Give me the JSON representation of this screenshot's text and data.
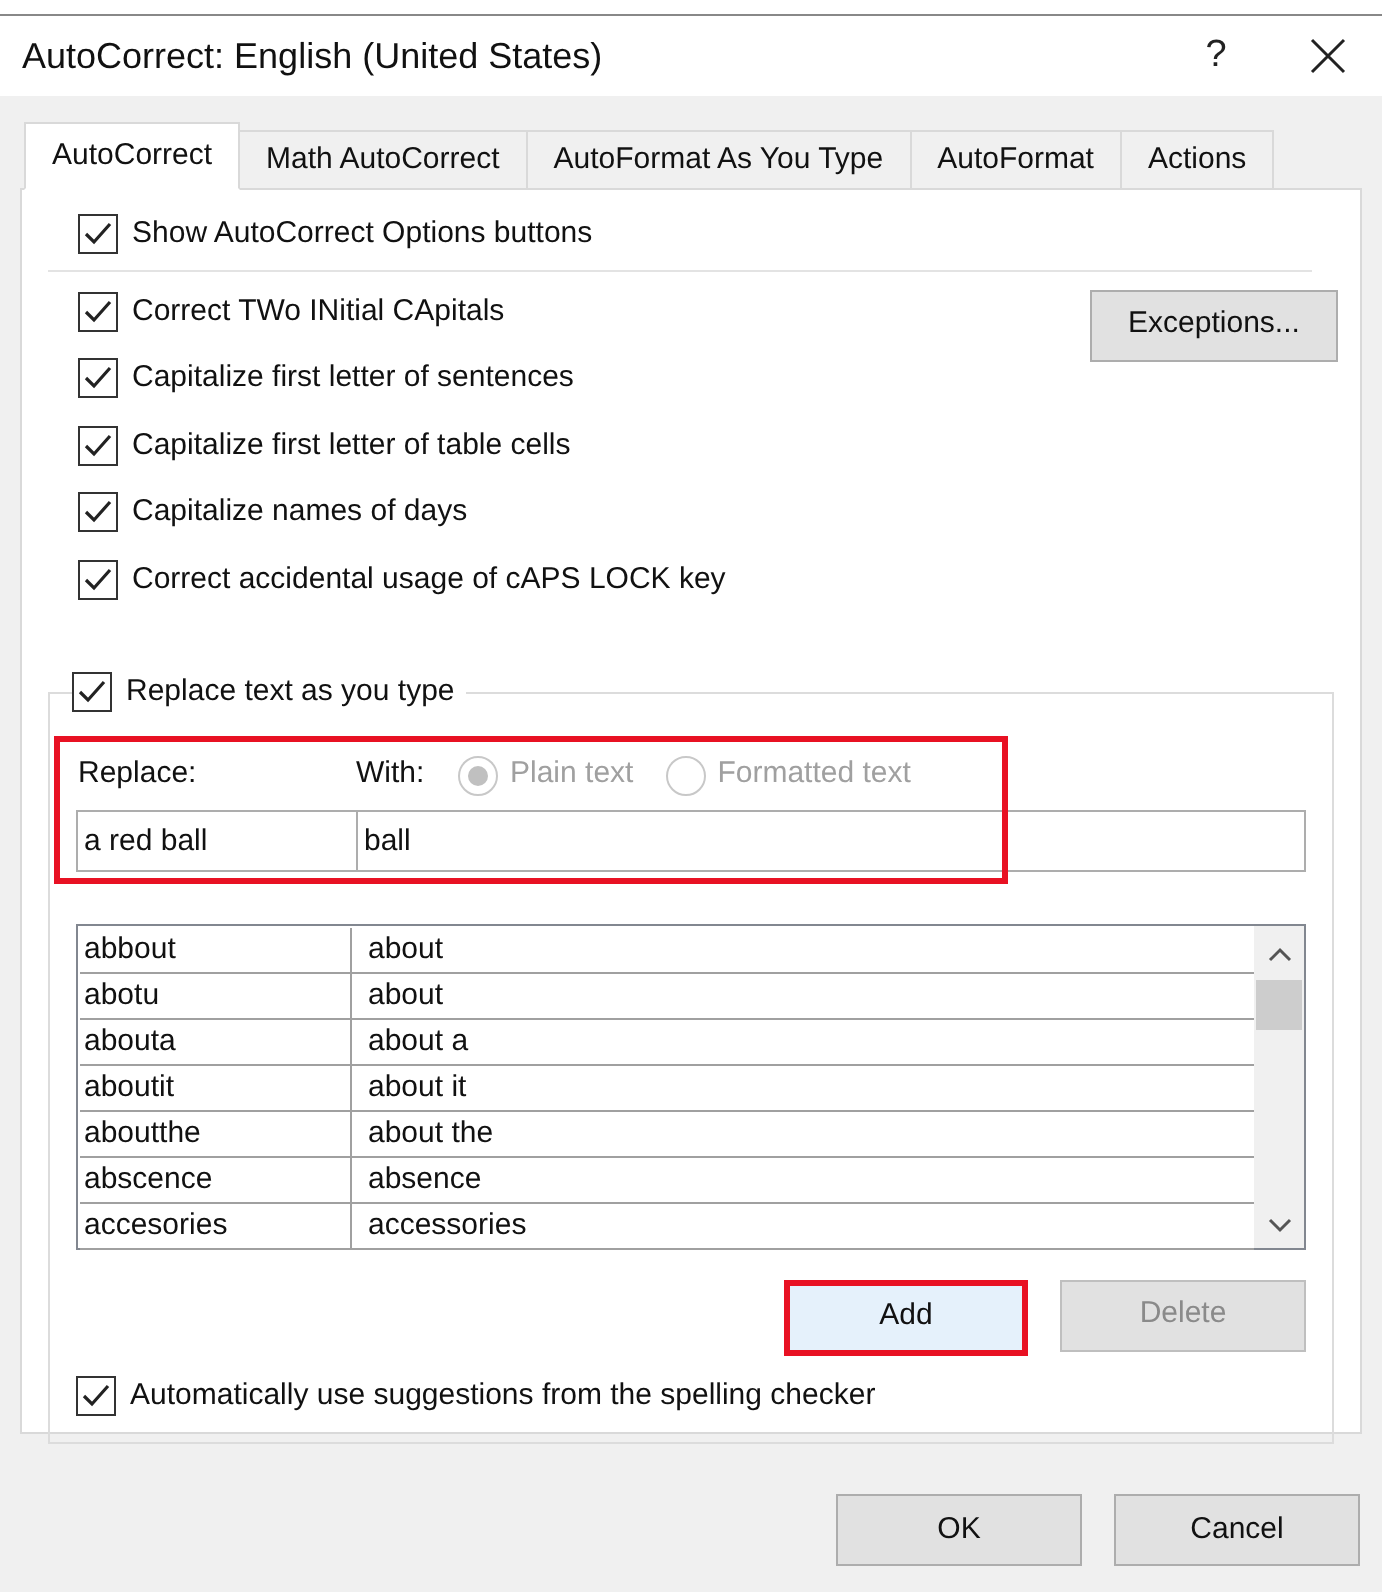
{
  "window": {
    "title": "AutoCorrect: English (United States)",
    "help": "?"
  },
  "tabs": [
    {
      "label": "AutoCorrect",
      "selected": true
    },
    {
      "label": "Math AutoCorrect",
      "selected": false
    },
    {
      "label": "AutoFormat As You Type",
      "selected": false
    },
    {
      "label": "AutoFormat",
      "selected": false
    },
    {
      "label": "Actions",
      "selected": false
    }
  ],
  "show_options": {
    "label": "Show AutoCorrect Options buttons",
    "checked": true
  },
  "options": [
    {
      "label": "Correct TWo INitial CApitals",
      "checked": true
    },
    {
      "label": "Capitalize first letter of sentences",
      "checked": true
    },
    {
      "label": "Capitalize first letter of table cells",
      "checked": true
    },
    {
      "label": "Capitalize names of days",
      "checked": true
    },
    {
      "label": "Correct accidental usage of cAPS LOCK key",
      "checked": true
    }
  ],
  "exceptions_button": "Exceptions...",
  "replace_section": {
    "label": "Replace text as you type",
    "checked": true,
    "highlighted": true,
    "replace_label": "Replace:",
    "with_label": "With:",
    "format_options": [
      {
        "label": "Plain text",
        "selected": true,
        "disabled": true
      },
      {
        "label": "Formatted text",
        "selected": false,
        "disabled": true
      }
    ],
    "replace_value": "a red ball",
    "with_value": "ball"
  },
  "table": {
    "rows": [
      [
        "abbout",
        "about"
      ],
      [
        "abotu",
        "about"
      ],
      [
        "abouta",
        "about a"
      ],
      [
        "aboutit",
        "about it"
      ],
      [
        "aboutthe",
        "about the"
      ],
      [
        "abscence",
        "absence"
      ],
      [
        "accesories",
        "accessories"
      ]
    ]
  },
  "add_button": {
    "label": "Add",
    "highlighted": true,
    "disabled": false
  },
  "delete_button": {
    "label": "Delete",
    "disabled": true
  },
  "spelling": {
    "label": "Automatically use suggestions from the spelling checker",
    "checked": true
  },
  "buttons": [
    "OK",
    "Cancel"
  ]
}
